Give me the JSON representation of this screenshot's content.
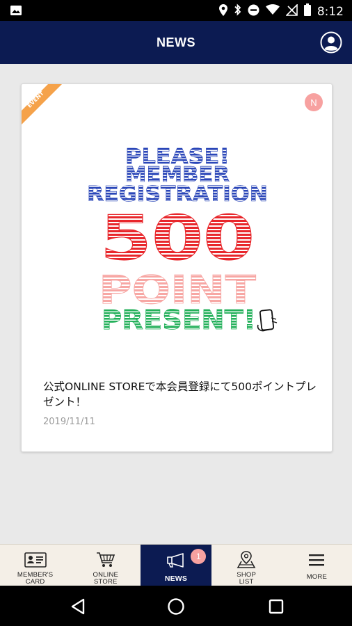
{
  "status_bar": {
    "time": "8:12",
    "icons": [
      "image-icon",
      "location-icon",
      "bluetooth-icon",
      "do-not-disturb-icon",
      "wifi-icon",
      "no-signal-icon",
      "battery-icon"
    ]
  },
  "header": {
    "title": "NEWS",
    "profile_icon": "account-circle-icon"
  },
  "news_card": {
    "ribbon_label": "EVENT",
    "badge": "N",
    "promo": {
      "line1": "PLEASE!",
      "line2": "MEMBER",
      "line3": "REGISTRATION",
      "line4": "500",
      "line5": "POINT",
      "line6": "PRESENT!"
    },
    "title": "公式ONLINE STOREで本会員登録にて500ポイントプレゼント！",
    "date": "2019/11/11"
  },
  "tabs": [
    {
      "label": "MEMBER'S\nCARD",
      "icon": "member-card-icon",
      "active": false
    },
    {
      "label": "ONLINE\nSTORE",
      "icon": "cart-icon",
      "active": false
    },
    {
      "label": "NEWS",
      "icon": "megaphone-icon",
      "active": true,
      "badge": "1"
    },
    {
      "label": "SHOP\nLIST",
      "icon": "map-pin-icon",
      "active": false
    },
    {
      "label": "MORE",
      "icon": "menu-icon",
      "active": false
    }
  ],
  "colors": {
    "header_bg": "#0c1b52",
    "ribbon": "#f5a24a",
    "badge": "#f7a1a0",
    "promo_blue": "#2a46b8",
    "promo_red": "#e8262b",
    "promo_pink": "#f7a7a4",
    "promo_green": "#23b05a",
    "tabbar_bg": "#f4efe7"
  }
}
